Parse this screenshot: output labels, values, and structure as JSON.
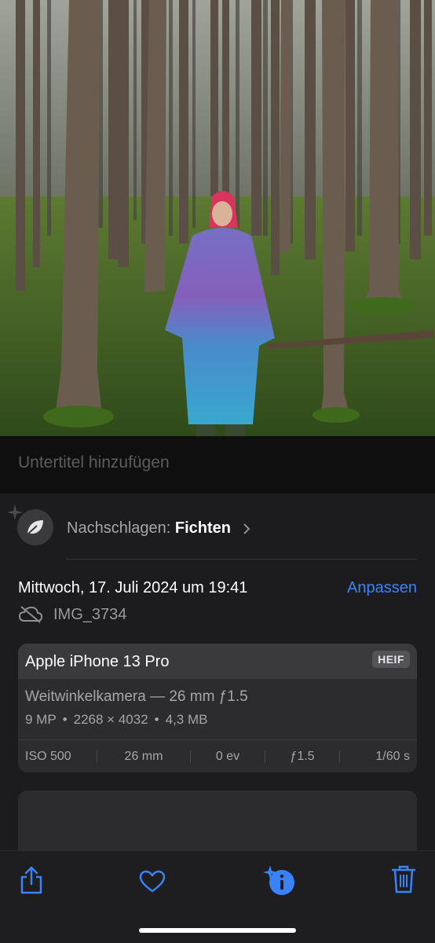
{
  "caption": {
    "placeholder": "Untertitel hinzufügen"
  },
  "lookup": {
    "prefix": "Nachschlagen:",
    "subject": "Fichten",
    "icon": "leaf-icon"
  },
  "info": {
    "date": "Mittwoch, 17. Juli 2024 um 19:41",
    "adjust_label": "Anpassen",
    "filename": "IMG_3734"
  },
  "camera": {
    "device": "Apple iPhone 13 Pro",
    "format": "HEIF",
    "lens": "Weitwinkelkamera — 26 mm ƒ1.5",
    "megapixels": "9 MP",
    "resolution": "2268 × 4032",
    "filesize": "4,3 MB",
    "exif": [
      "ISO 500",
      "26 mm",
      "0 ev",
      "ƒ1.5",
      "1/60 s"
    ]
  },
  "toolbar": {
    "items": [
      "share-icon",
      "heart-icon",
      "info-icon",
      "trash-icon"
    ]
  },
  "colors": {
    "accent": "#3a82f7",
    "panel": "#1c1c1e",
    "card": "#2c2c2e"
  }
}
